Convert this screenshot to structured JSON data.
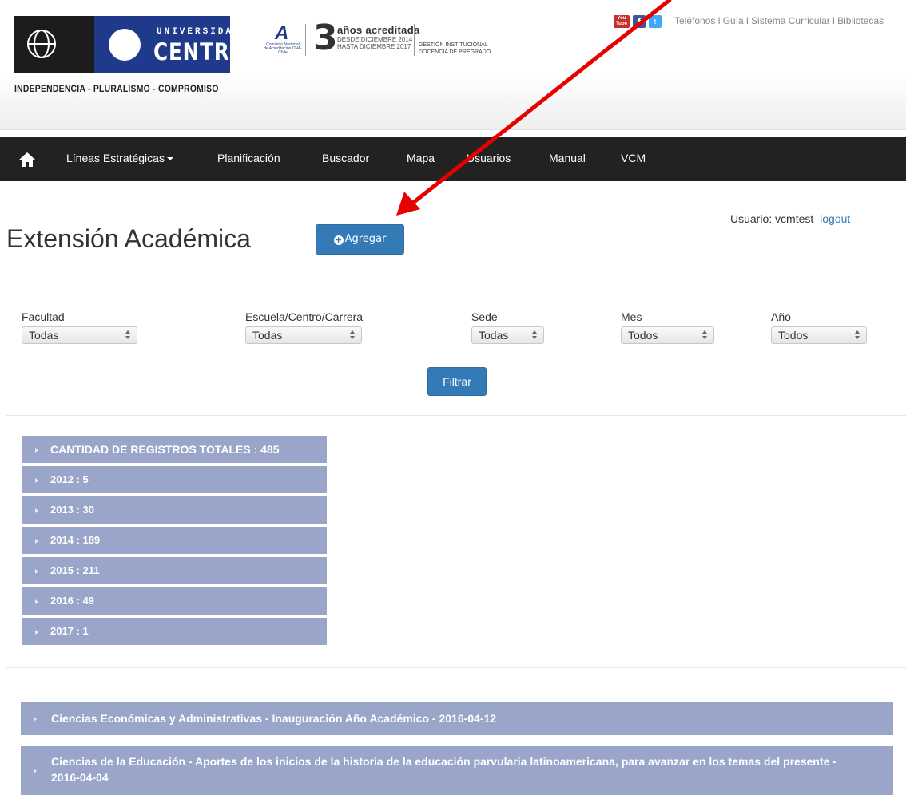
{
  "header": {
    "university_small": "UNIVERSIDAD",
    "university_big": "CENTRAL",
    "tagline": "INDEPENDENCIA - PLURALISMO - COMPROMISO",
    "accreditation": {
      "years": "3",
      "years_text": "años acreditada",
      "desde": "DESDE DICIEMBRE 2014",
      "hasta": "HASTA DICIEMBRE 2017",
      "area1": "GESTIÓN INSTITUCIONAL",
      "area2": "DOCENCIA DE PREGRADO",
      "agency_mark": "A",
      "agency_name": "Comisión Nacional de Acreditación CNA-Chile"
    },
    "social": {
      "youtube_top": "You",
      "youtube_bottom": "Tube",
      "facebook": "f",
      "twitter": "t"
    },
    "top_links": "Teléfonos l Guía l Sistema Curricular l Bibliotecas"
  },
  "nav": {
    "items": [
      "Líneas Estratégicas",
      "Planificación",
      "Buscador",
      "Mapa",
      "Usuarios",
      "Manual",
      "VCM"
    ]
  },
  "page": {
    "title": "Extensión Académica",
    "add_button": "Agregar",
    "user_label": "Usuario:",
    "username": "vcmtest",
    "logout": "logout"
  },
  "filters": {
    "facultad": {
      "label": "Facultad",
      "value": "Todas"
    },
    "escuela": {
      "label": "Escuela/Centro/Carrera",
      "value": "Todas"
    },
    "sede": {
      "label": "Sede",
      "value": "Todas"
    },
    "mes": {
      "label": "Mes",
      "value": "Todos"
    },
    "anio": {
      "label": "Año",
      "value": "Todos"
    },
    "button": "Filtrar"
  },
  "stats": [
    "CANTIDAD DE REGISTROS TOTALES : 485",
    "2012 : 5",
    "2013 : 30",
    "2014 : 189",
    "2015 : 211",
    "2016 : 49",
    "2017 : 1"
  ],
  "events": [
    "Ciencias Económicas y Administrativas - Inauguración Año Académico - 2016-04-12",
    "Ciencias de la Educación - Aportes de los inicios de la historia de la educación parvularia latinoamericana, para avanzar en los temas del presente - 2016-04-04"
  ],
  "colors": {
    "navbar": "#222222",
    "primary_button": "#337ab7",
    "accordion": "#99a5c9",
    "annotation_arrow": "#e60000"
  }
}
